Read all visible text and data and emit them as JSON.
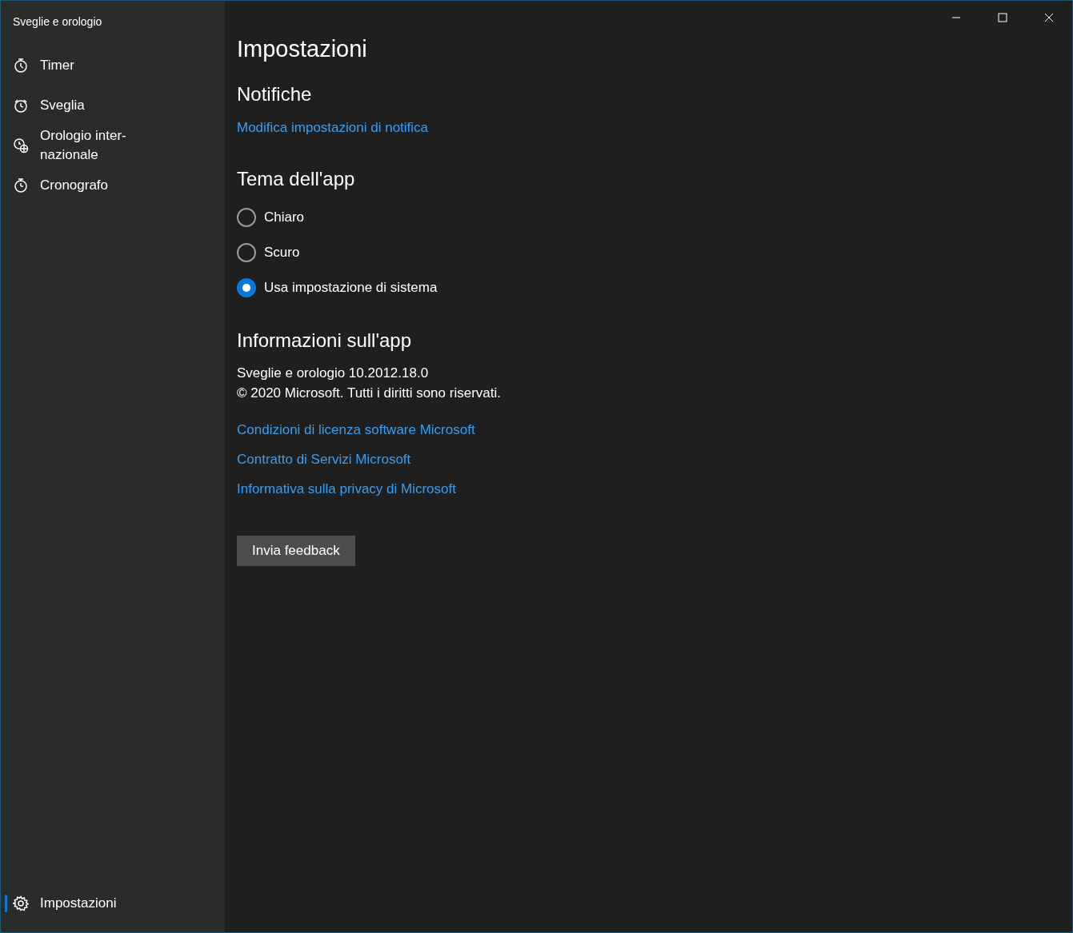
{
  "app_title": "Sveglie e orologio",
  "nav": [
    {
      "kind": "timer",
      "label": "Timer",
      "selected": false
    },
    {
      "kind": "alarm",
      "label": "Sveglia",
      "selected": false
    },
    {
      "kind": "world-clock",
      "label": "Orologio inter-nazionale",
      "selected": false
    },
    {
      "kind": "stopwatch",
      "label": "Cronografo",
      "selected": false
    }
  ],
  "settings_nav": {
    "kind": "settings",
    "label": "Impostazioni",
    "selected": true
  },
  "page_title": "Impostazioni",
  "notifications": {
    "heading": "Notifiche",
    "link": "Modifica impostazioni di notifica"
  },
  "theme": {
    "heading": "Tema dell'app",
    "options": [
      {
        "label": "Chiaro",
        "selected": false
      },
      {
        "label": "Scuro",
        "selected": false
      },
      {
        "label": "Usa impostazione di sistema",
        "selected": true
      }
    ]
  },
  "about": {
    "heading": "Informazioni sull'app",
    "version": "Sveglie e orologio 10.2012.18.0",
    "copyright": "© 2020 Microsoft. Tutti i diritti sono riservati.",
    "links": [
      "Condizioni di licenza software Microsoft",
      "Contratto di Servizi Microsoft",
      "Informativa sulla privacy di Microsoft"
    ]
  },
  "feedback_button": "Invia feedback"
}
